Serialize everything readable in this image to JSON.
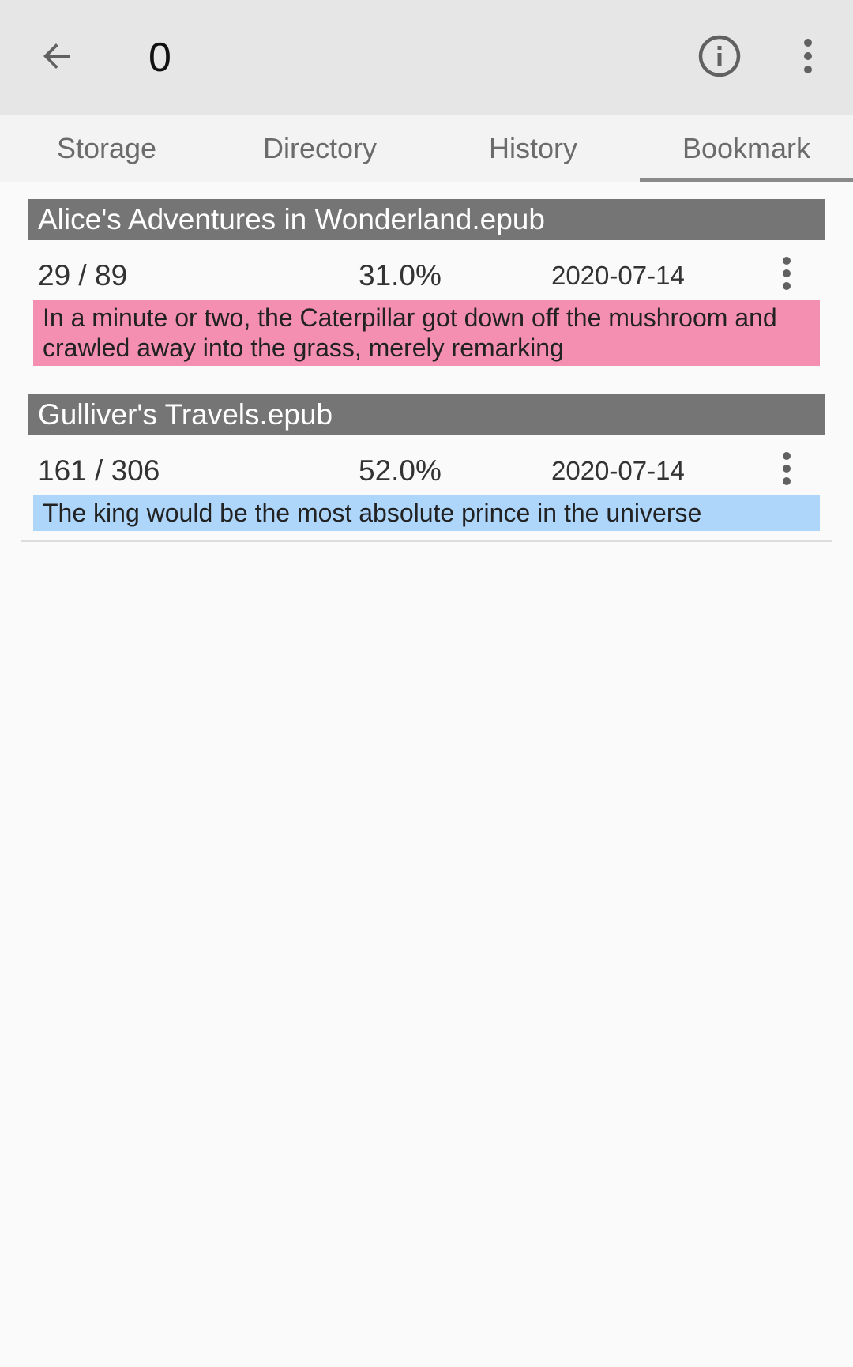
{
  "toolbar": {
    "back_icon": "arrow-back-icon",
    "title": "0",
    "info_icon": "info-icon",
    "more_icon": "more-vert-icon"
  },
  "tabs": [
    {
      "label": "Storage",
      "active": false
    },
    {
      "label": "Directory",
      "active": false
    },
    {
      "label": "History",
      "active": false
    },
    {
      "label": "Bookmark",
      "active": true
    }
  ],
  "bookmarks": [
    {
      "book": "Alice's Adventures in Wonderland.epub",
      "pages": "29 / 89",
      "percent": "31.0%",
      "date": "2020-07-14",
      "snippet": "In a minute or two, the Caterpillar got down off the mushroom and crawled away into the grass, merely remarking",
      "highlight_color": "#f48fb1"
    },
    {
      "book": "Gulliver's Travels.epub",
      "pages": "161 / 306",
      "percent": "52.0%",
      "date": "2020-07-14",
      "snippet": "The king would be the most absolute prince in the universe",
      "highlight_color": "#aed6fb"
    }
  ],
  "colors": {
    "toolbar_bg": "#e6e6e6",
    "tabs_bg": "#f3f3f3",
    "group_header_bg": "#757575",
    "page_bg": "#fafafa"
  }
}
